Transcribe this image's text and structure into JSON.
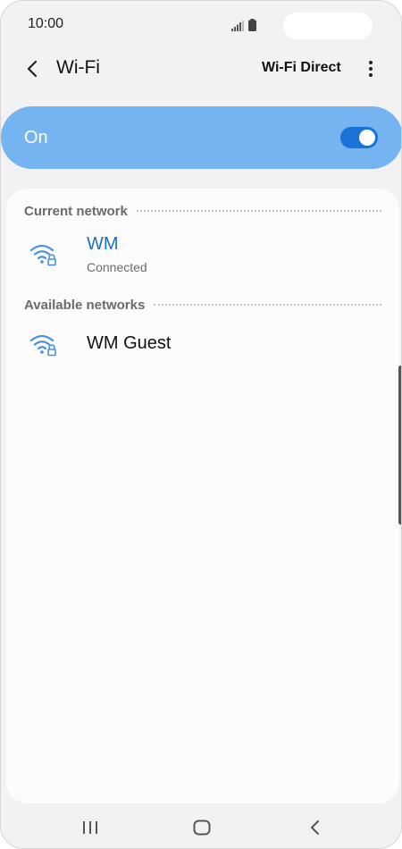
{
  "status_bar": {
    "time": "10:00",
    "icons": [
      "signal-icon",
      "battery-icon"
    ]
  },
  "header": {
    "title": "Wi-Fi",
    "back_icon": "chevron-left-icon",
    "wifi_direct_label": "Wi-Fi Direct",
    "more_icon": "more-vertical-icon"
  },
  "master_switch": {
    "label": "On",
    "state": "on"
  },
  "current_network": {
    "section_title": "Current network",
    "network": {
      "name": "WM",
      "status": "Connected",
      "icon": "wifi-secured-icon"
    }
  },
  "available_networks": {
    "section_title": "Available networks",
    "networks": [
      {
        "name": "WM Guest",
        "icon": "wifi-secured-icon"
      }
    ]
  },
  "nav_bar": {
    "icons": [
      "recent-apps-icon",
      "home-icon",
      "back-icon"
    ]
  },
  "colors": {
    "accent": "#1a73d9",
    "switch_bar": "#75b3f1",
    "wifi_icon": "#4a90e2",
    "background": "#f2f2f2",
    "connected_name": "#1a6fc4"
  }
}
